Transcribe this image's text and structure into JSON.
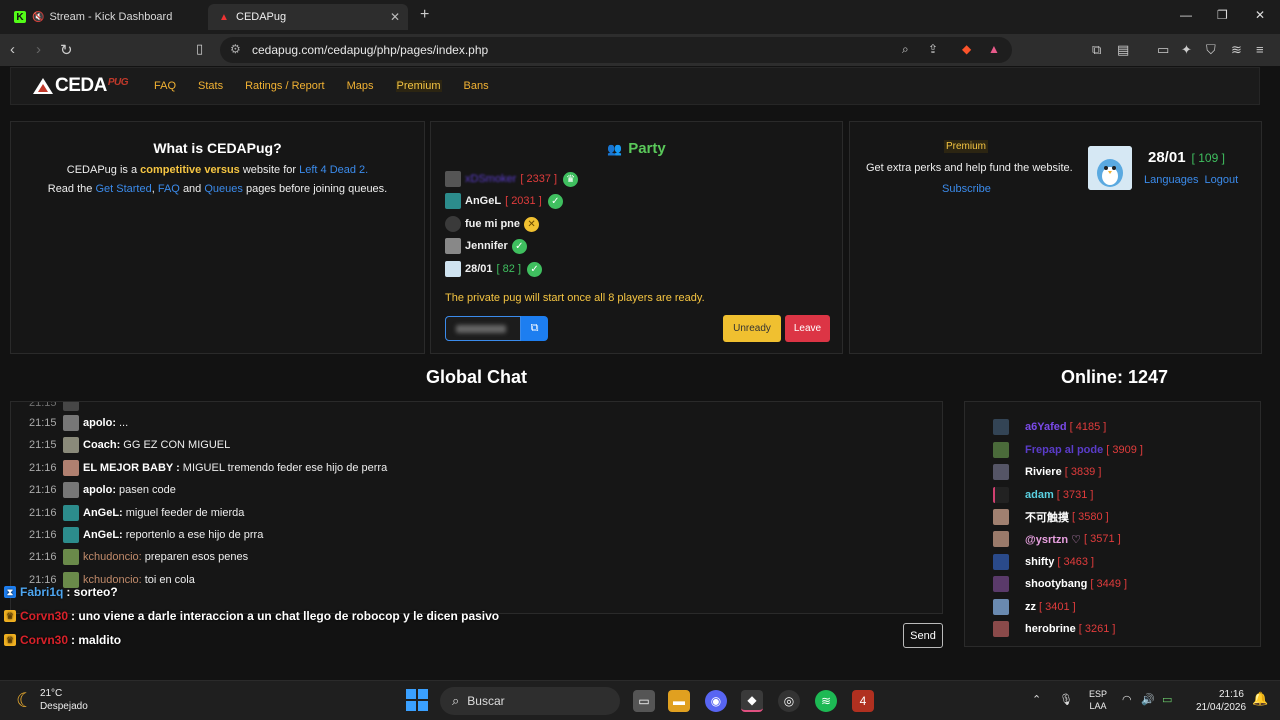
{
  "browser": {
    "tabs": [
      {
        "title": "Stream - Kick Dashboard"
      },
      {
        "title": "CEDAPug"
      }
    ],
    "url": "cedapug.com/cedapug/php/pages/index.php"
  },
  "nav": {
    "logo": "CEDA",
    "logo_sub": "PUG",
    "links": [
      "FAQ",
      "Stats",
      "Ratings / Report",
      "Maps",
      "Premium",
      "Bans"
    ]
  },
  "about": {
    "title": "What is CEDAPug?",
    "line1_pre": "CEDAPug is a",
    "line1_hl": "competitive versus",
    "line1_mid": "website for",
    "line1_link": "Left 4 Dead 2.",
    "line2_pre": "Read the",
    "line2_link1": "Get Started",
    "line2_sep": ",",
    "line2_link2": "FAQ",
    "line2_and": "and",
    "line2_link3": "Queues",
    "line2_post": "pages before joining queues."
  },
  "party": {
    "title": "Party",
    "members": [
      {
        "name": "xDSmoker",
        "rank": "2337",
        "status": "leader"
      },
      {
        "name": "AnGeL",
        "rank": "2031",
        "status": "ready"
      },
      {
        "name": "fue mi pne",
        "rank": "",
        "status": "pending"
      },
      {
        "name": "Jennifer",
        "rank": "",
        "status": "ready"
      },
      {
        "name": "28/01",
        "rank": "82",
        "status": "ready"
      }
    ],
    "message": "The private pug will start once all 8 players are ready.",
    "unready_label": "Unready",
    "leave_label": "Leave"
  },
  "premium": {
    "label": "Premium",
    "text": "Get extra perks and help fund the website.",
    "subscribe": "Subscribe"
  },
  "profile": {
    "name": "28/01",
    "rank": "109",
    "languages": "Languages",
    "logout": "Logout"
  },
  "chat": {
    "title": "Global Chat",
    "messages": [
      {
        "time": "21:15",
        "user": "apolo:",
        "text": "..."
      },
      {
        "time": "21:15",
        "user": "Coach:",
        "text": "GG EZ CON MIGUEL"
      },
      {
        "time": "21:16",
        "user": "EL MEJOR BABY :",
        "text": "MIGUEL tremendo feder ese hijo de perra"
      },
      {
        "time": "21:16",
        "user": "apolo:",
        "text": "pasen code"
      },
      {
        "time": "21:16",
        "user": "AnGeL:",
        "text": "miguel feeder de mierda"
      },
      {
        "time": "21:16",
        "user": "AnGeL:",
        "text": "reportenlo a ese hijo de prra"
      },
      {
        "time": "21:16",
        "user": "kchudoncio:",
        "text": "preparen esos penes"
      },
      {
        "time": "21:16",
        "user": "kchudoncio:",
        "text": "toi en cola"
      }
    ],
    "send_label": "Send"
  },
  "stream_overlay": [
    {
      "user": "Fabri1q",
      "text": ": sorteo?"
    },
    {
      "user": "Corvn30",
      "text": ": uno viene a darle interaccion a un chat llego de robocop y le dicen pasivo"
    },
    {
      "user": "Corvn30",
      "text": ": maldito"
    }
  ],
  "online": {
    "title": "Online: 1247",
    "users": [
      {
        "name": "a6Yafed",
        "rank": "4185"
      },
      {
        "name": "Frepap al pode",
        "rank": "3909"
      },
      {
        "name": "Riviere",
        "rank": "3839"
      },
      {
        "name": "adam",
        "rank": "3731"
      },
      {
        "name": "不可触摸",
        "rank": "3580"
      },
      {
        "name": "@ysrtzn ♡",
        "rank": "3571"
      },
      {
        "name": "shifty",
        "rank": "3463"
      },
      {
        "name": "shootybang",
        "rank": "3449"
      },
      {
        "name": "zz",
        "rank": "3401"
      },
      {
        "name": "herobrine",
        "rank": "3261"
      }
    ]
  },
  "taskbar": {
    "temp": "21°C",
    "weather": "Despejado",
    "search": "Buscar",
    "lang1": "ESP",
    "lang2": "LAA",
    "time": "21:16",
    "date": "21/04/2026"
  },
  "colors": {
    "accent_yellow": "#f5c542",
    "link_blue": "#3b8beb",
    "party_green": "#5ac85a",
    "rank_red": "#e03c3c",
    "danger": "#dc3545"
  }
}
